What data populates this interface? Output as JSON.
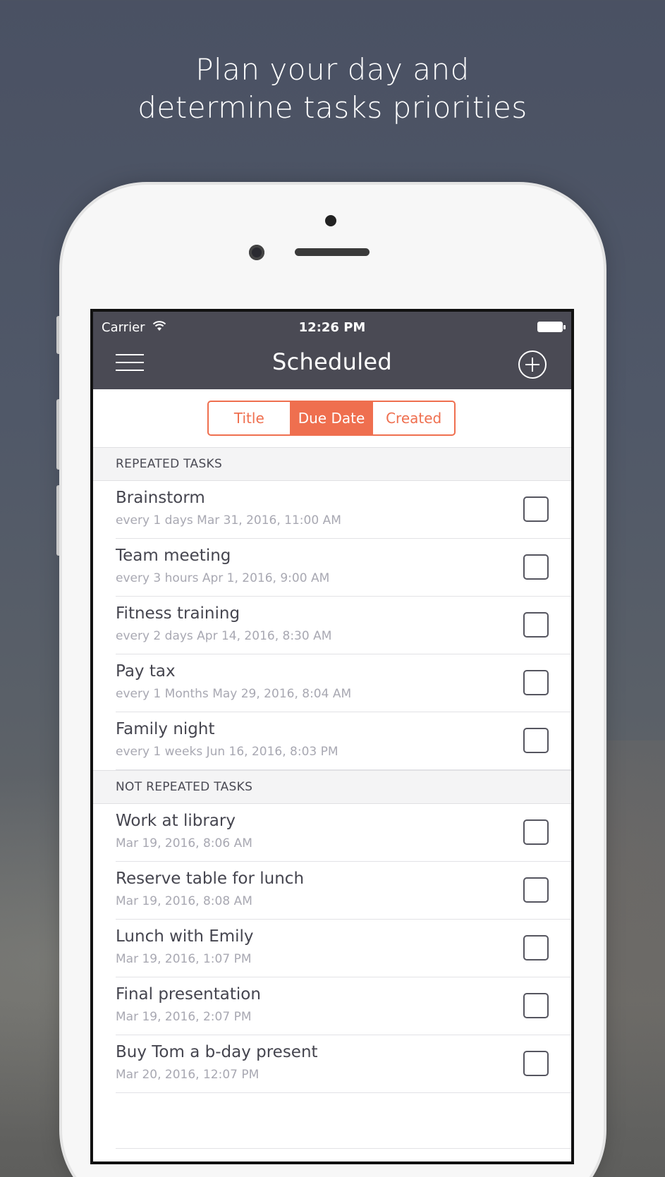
{
  "headline": {
    "line1": "Plan your day and",
    "line2": "determine tasks priorities"
  },
  "status_bar": {
    "carrier": "Carrier",
    "time": "12:26 PM",
    "wifi_icon": "wifi-icon",
    "battery_icon": "battery-icon"
  },
  "nav": {
    "title": "Scheduled",
    "menu_icon": "hamburger-menu-icon",
    "add_icon": "plus-circle-icon"
  },
  "sort_tabs": [
    {
      "label": "Title",
      "active": false
    },
    {
      "label": "Due Date",
      "active": true
    },
    {
      "label": "Created",
      "active": false
    }
  ],
  "sections": {
    "repeated": {
      "header": "REPEATED TASKS",
      "tasks": [
        {
          "title": "Brainstorm",
          "subtitle": "every 1 days Mar 31, 2016, 11:00 AM",
          "done": false
        },
        {
          "title": "Team meeting",
          "subtitle": "every 3 hours Apr 1, 2016, 9:00 AM",
          "done": false
        },
        {
          "title": "Fitness training",
          "subtitle": "every 2 days Apr 14, 2016, 8:30 AM",
          "done": false
        },
        {
          "title": "Pay tax",
          "subtitle": "every 1 Months May 29, 2016, 8:04 AM",
          "done": false
        },
        {
          "title": "Family night",
          "subtitle": "every 1 weeks Jun 16, 2016, 8:03 PM",
          "done": false
        }
      ]
    },
    "not_repeated": {
      "header": "NOT REPEATED TASKS",
      "tasks": [
        {
          "title": "Work at library",
          "subtitle": "Mar 19, 2016, 8:06 AM",
          "done": false
        },
        {
          "title": "Reserve table for lunch",
          "subtitle": "Mar 19, 2016, 8:08 AM",
          "done": false
        },
        {
          "title": "Lunch with Emily",
          "subtitle": "Mar 19, 2016, 1:07 PM",
          "done": false
        },
        {
          "title": "Final presentation",
          "subtitle": "Mar 19, 2016, 2:07 PM",
          "done": false
        },
        {
          "title": "Buy Tom a b-day present",
          "subtitle": "Mar 20, 2016, 12:07 PM",
          "done": false
        }
      ]
    }
  },
  "colors": {
    "accent": "#ef6f4f",
    "nav_bar": "#4a4a54"
  }
}
